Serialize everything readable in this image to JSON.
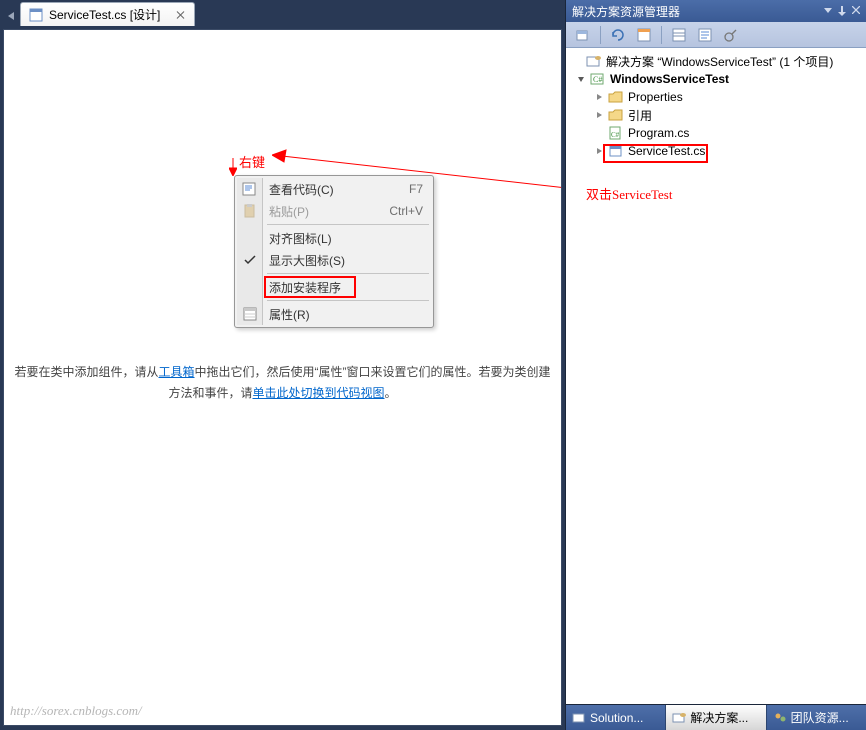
{
  "tab": {
    "label": "ServiceTest.cs [设计]"
  },
  "annotations": {
    "rightClick": "右键",
    "doubleClick": "双击ServiceTest"
  },
  "contextMenu": {
    "viewCode": {
      "label": "查看代码(C)",
      "shortcut": "F7"
    },
    "paste": {
      "label": "粘贴(P)",
      "shortcut": "Ctrl+V"
    },
    "alignIcons": {
      "label": "对齐图标(L)"
    },
    "largeIcons": {
      "label": "显示大图标(S)"
    },
    "addInstaller": {
      "label": "添加安装程序"
    },
    "properties": {
      "label": "属性(R)"
    }
  },
  "hint": {
    "prefix1": "若要在类中添加组件，请从",
    "toolbox": "工具箱",
    "middle": "中拖出它们，然后使用“属性”窗口来设置它们的属性。若要为类创建方法和事件，请",
    "link2": "单击此处切换到代码视图",
    "suffix": "。"
  },
  "solutionPanel": {
    "title": "解决方案资源管理器",
    "root": "解决方案 “WindowsServiceTest” (1 个项目)",
    "project": "WindowsServiceTest",
    "properties": "Properties",
    "references": "引用",
    "program": "Program.cs",
    "service": "ServiceTest.cs"
  },
  "bottomTabs": {
    "solution": "Solution...",
    "slnExplorer": "解决方案...",
    "team": "团队资源..."
  },
  "watermark": "http://sorex.cnblogs.com/"
}
